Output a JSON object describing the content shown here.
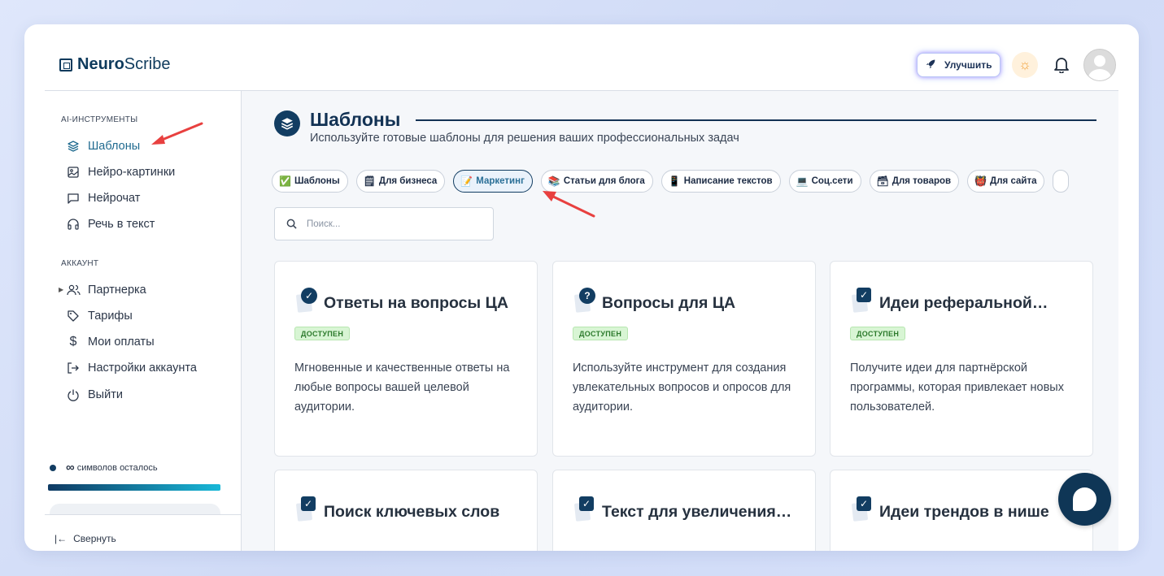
{
  "brand": {
    "bold": "Neuro",
    "regular": "Scribe"
  },
  "header": {
    "upgrade_label": "Улучшить",
    "theme_icon": "sun-icon",
    "notifications_icon": "bell-icon",
    "avatar_icon": "user-avatar-icon"
  },
  "sidebar": {
    "ai_section_title": "AI-ИНСТРУМЕНТЫ",
    "ai_items": [
      {
        "label": "Шаблоны",
        "icon": "layers-icon",
        "active": true
      },
      {
        "label": "Нейро-картинки",
        "icon": "image-icon"
      },
      {
        "label": "Нейрочат",
        "icon": "chat-icon"
      },
      {
        "label": "Речь в текст",
        "icon": "headphones-icon"
      }
    ],
    "account_section_title": "АККАУНТ",
    "account_items": [
      {
        "label": "Партнерка",
        "icon": "users-icon"
      },
      {
        "label": "Тарифы",
        "icon": "tag-icon"
      },
      {
        "label": "Мои оплаты",
        "icon": "dollar-icon"
      },
      {
        "label": "Настройки аккаунта",
        "icon": "logout-arrow-icon"
      },
      {
        "label": "Выйти",
        "icon": "power-icon"
      }
    ],
    "credits": {
      "value": "∞",
      "text": "символов осталось"
    },
    "collapse_label": "Свернуть"
  },
  "main": {
    "title": "Шаблоны",
    "subtitle": "Используйте готовые шаблоны для решения ваших профессиональных задач",
    "chips": [
      {
        "emoji": "✅",
        "label": "Шаблоны"
      },
      {
        "emoji": "🗒",
        "label": "Для бизнеса"
      },
      {
        "emoji": "📝",
        "label": "Маркетинг",
        "active": true
      },
      {
        "emoji": "📚",
        "label": "Статьи для блога"
      },
      {
        "emoji": "📱",
        "label": "Написание текстов"
      },
      {
        "emoji": "💻",
        "label": "Соц.сети"
      },
      {
        "emoji": "🗃",
        "label": "Для товаров"
      },
      {
        "emoji": "👹",
        "label": "Для сайта"
      }
    ],
    "search_placeholder": "Поиск...",
    "cards": [
      {
        "title": "Ответы на вопросы ЦА",
        "badge": "✓",
        "status": "ДОСТУПЕН",
        "description": "Мгновенные и качественные ответы на любые вопросы вашей целевой аудитории."
      },
      {
        "title": "Вопросы для ЦА",
        "badge": "?",
        "status": "ДОСТУПЕН",
        "description": "Используйте инструмент для создания увлекательных вопросов и опросов для аудитории."
      },
      {
        "title": "Идеи реферальной…",
        "badge": "✓",
        "status": "ДОСТУПЕН",
        "description": "Получите идеи для партнёрской программы, которая привлекает новых пользователей."
      },
      {
        "title": "Поиск ключевых слов",
        "badge": "✓"
      },
      {
        "title": "Текст для увеличения…",
        "badge": "✓"
      },
      {
        "title": "Идеи трендов в нише",
        "badge": "✓"
      }
    ]
  },
  "colors": {
    "primary": "#123d62",
    "accent": "#1f6a8f",
    "annotation_arrow": "#e8403f",
    "status_bg": "#d8f5d4"
  }
}
